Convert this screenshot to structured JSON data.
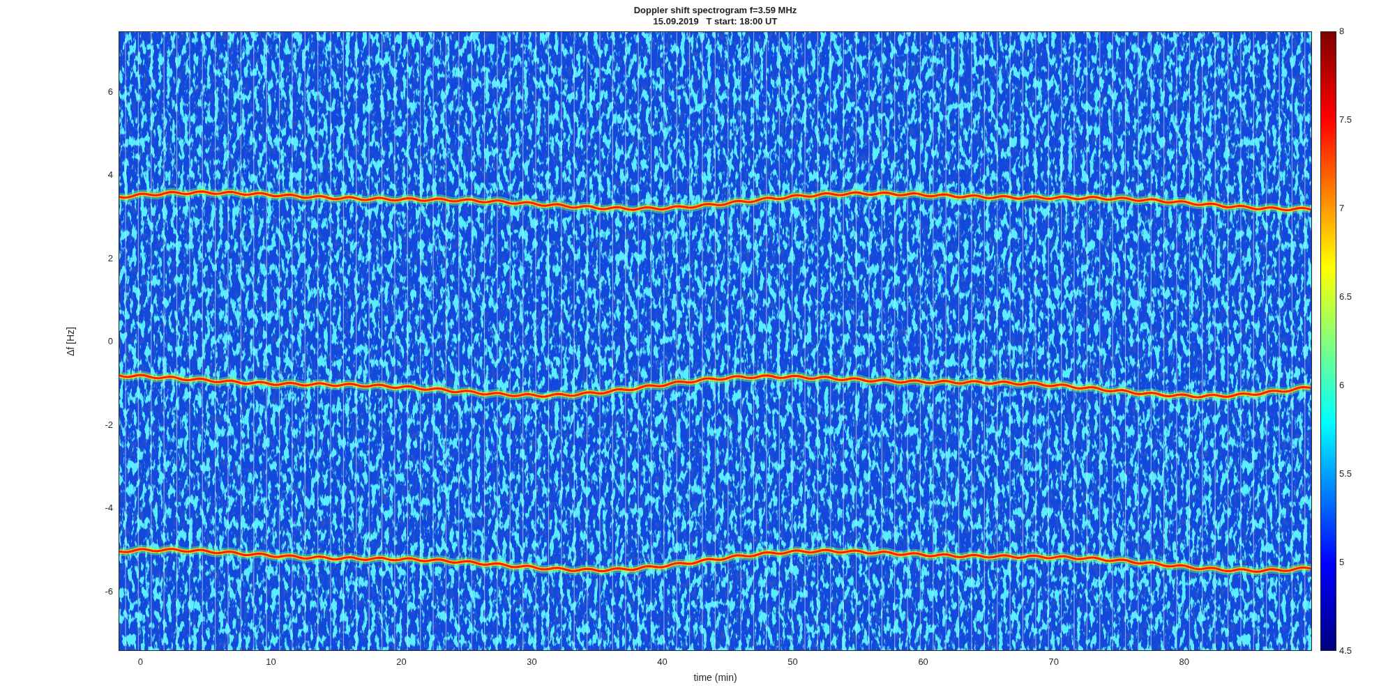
{
  "figure": {
    "title_lines": [
      "Doppler shift spectrogram f=3.59 MHz",
      "15.09.2019   T start: 18:00 UT"
    ],
    "axes": {
      "xlabel": "time (min)",
      "ylabel": "Δf [Hz]",
      "xticks": [
        "0",
        "10",
        "20",
        "30",
        "40",
        "50",
        "60",
        "70",
        "80"
      ],
      "yticks": [
        "6",
        "4",
        "2",
        "0",
        "-2",
        "-4",
        "-6"
      ]
    },
    "colorbar": {
      "ticks": [
        "8",
        "7.5",
        "7",
        "6.5",
        "6",
        "5.5",
        "5",
        "4.5"
      ]
    }
  }
}
